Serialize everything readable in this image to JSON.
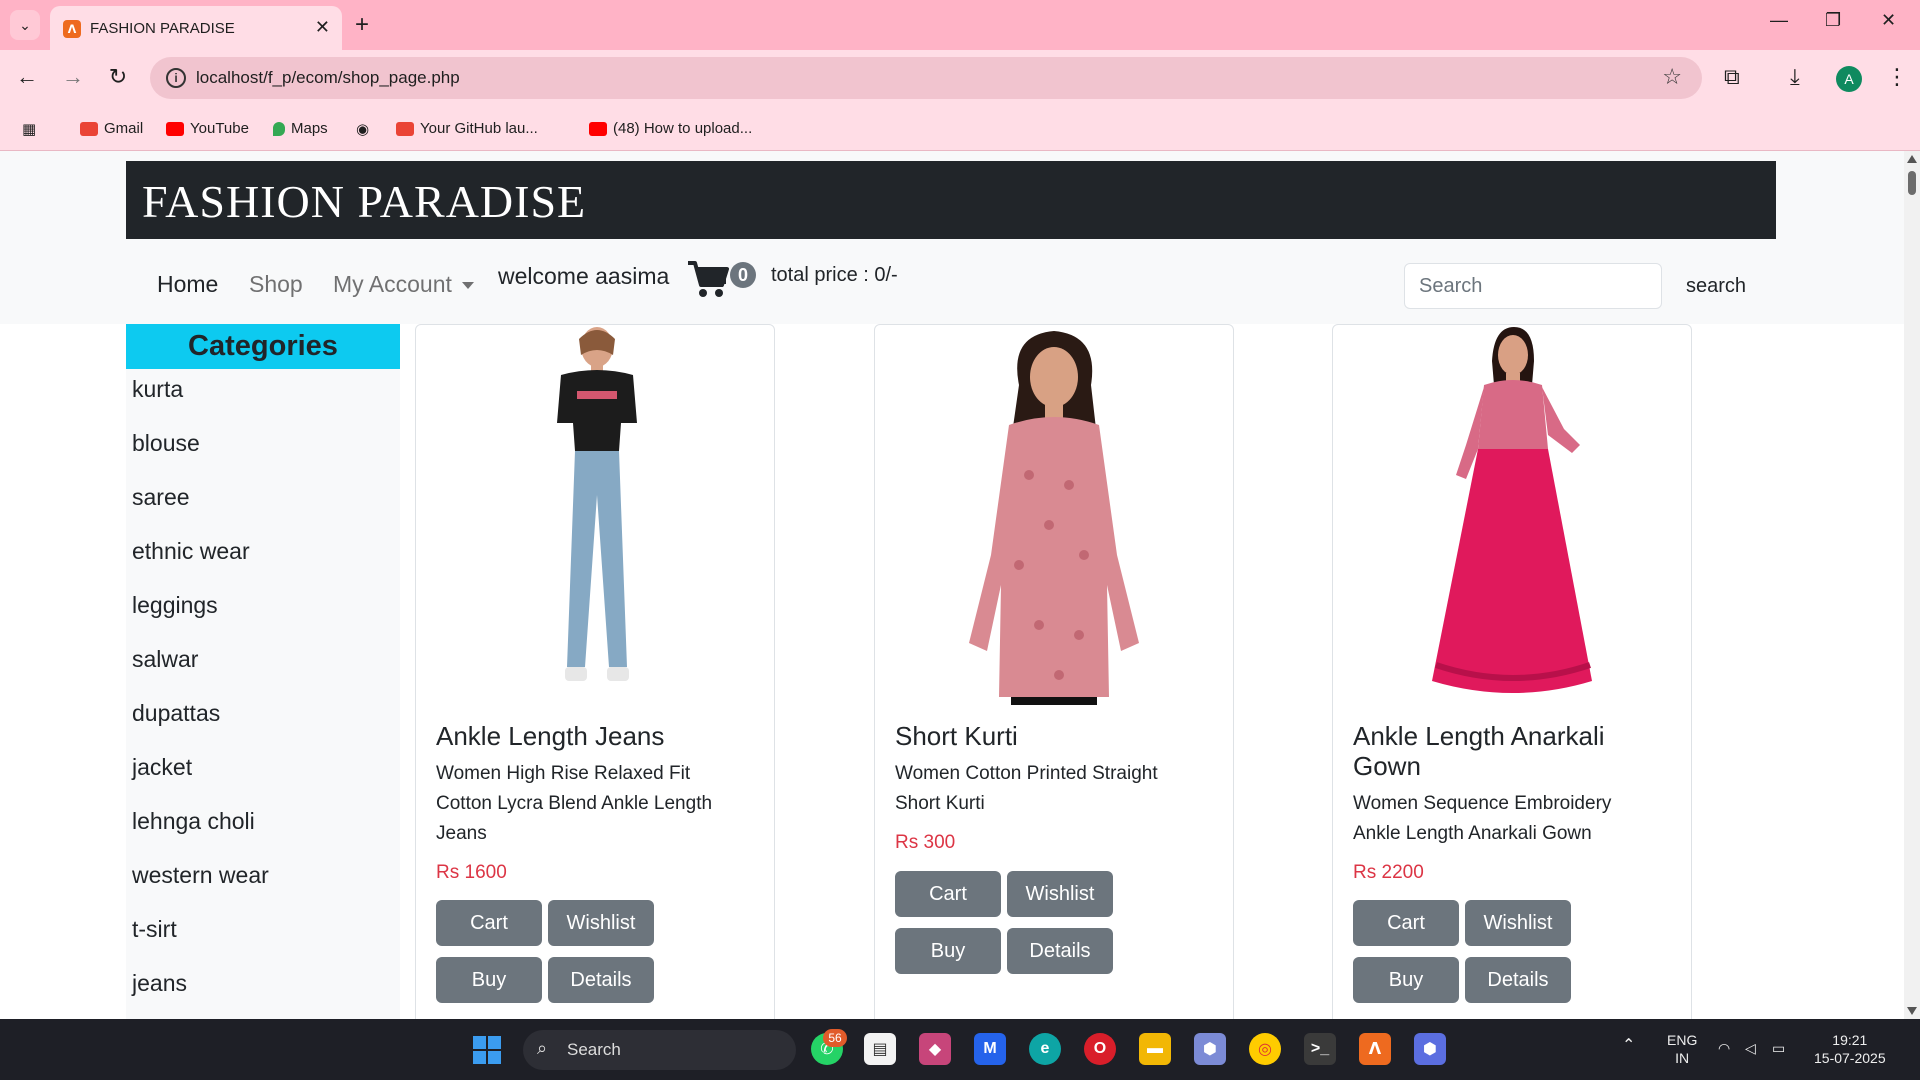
{
  "browser": {
    "tab_title": "FASHION PARADISE",
    "url": "localhost/f_p/ecom/shop_page.php",
    "bookmarks": [
      "Gmail",
      "YouTube",
      "Maps",
      "Your GitHub lau...",
      "(48) How to upload..."
    ],
    "profile_initial": "A"
  },
  "site": {
    "brand": "FASHION PARADISE",
    "nav": {
      "home": "Home",
      "shop": "Shop",
      "account": "My Account"
    },
    "welcome": "welcome aasima",
    "cart_count": "0",
    "total_price": "total price : 0/-",
    "search_placeholder": "Search",
    "search_button": "search"
  },
  "sidebar": {
    "heading": "Categories",
    "items": [
      "kurta",
      "blouse",
      "saree",
      "ethnic wear",
      "leggings",
      "salwar",
      "dupattas",
      "jacket",
      "lehnga choli",
      "western wear",
      "t-sirt",
      "jeans"
    ]
  },
  "products": [
    {
      "name": "Ankle Length Jeans",
      "desc": "Women High Rise Relaxed Fit Cotton Lycra Blend Ankle Length Jeans",
      "price": "Rs 1600",
      "buttons": {
        "cart": "Cart",
        "wishlist": "Wishlist",
        "buy": "Buy",
        "details": "Details"
      }
    },
    {
      "name": "Short Kurti",
      "desc": "Women Cotton Printed Straight Short Kurti",
      "price": "Rs 300",
      "buttons": {
        "cart": "Cart",
        "wishlist": "Wishlist",
        "buy": "Buy",
        "details": "Details"
      }
    },
    {
      "name": "Ankle Length Anarkali Gown",
      "desc": "Women Sequence Embroidery Ankle Length Anarkali Gown",
      "price": "Rs 2200",
      "buttons": {
        "cart": "Cart",
        "wishlist": "Wishlist",
        "buy": "Buy",
        "details": "Details"
      }
    }
  ],
  "taskbar": {
    "search": "Search",
    "notification_count": "56",
    "lang": "ENG",
    "region": "IN",
    "time": "19:21",
    "date": "15-07-2025"
  },
  "colors": {
    "tab_strip": "#ffb3c6",
    "toolbar": "#ffdde6",
    "brand_bg": "#212529",
    "categories_head": "#0dcaf0",
    "price": "#dc3545",
    "button": "#6c757d"
  }
}
